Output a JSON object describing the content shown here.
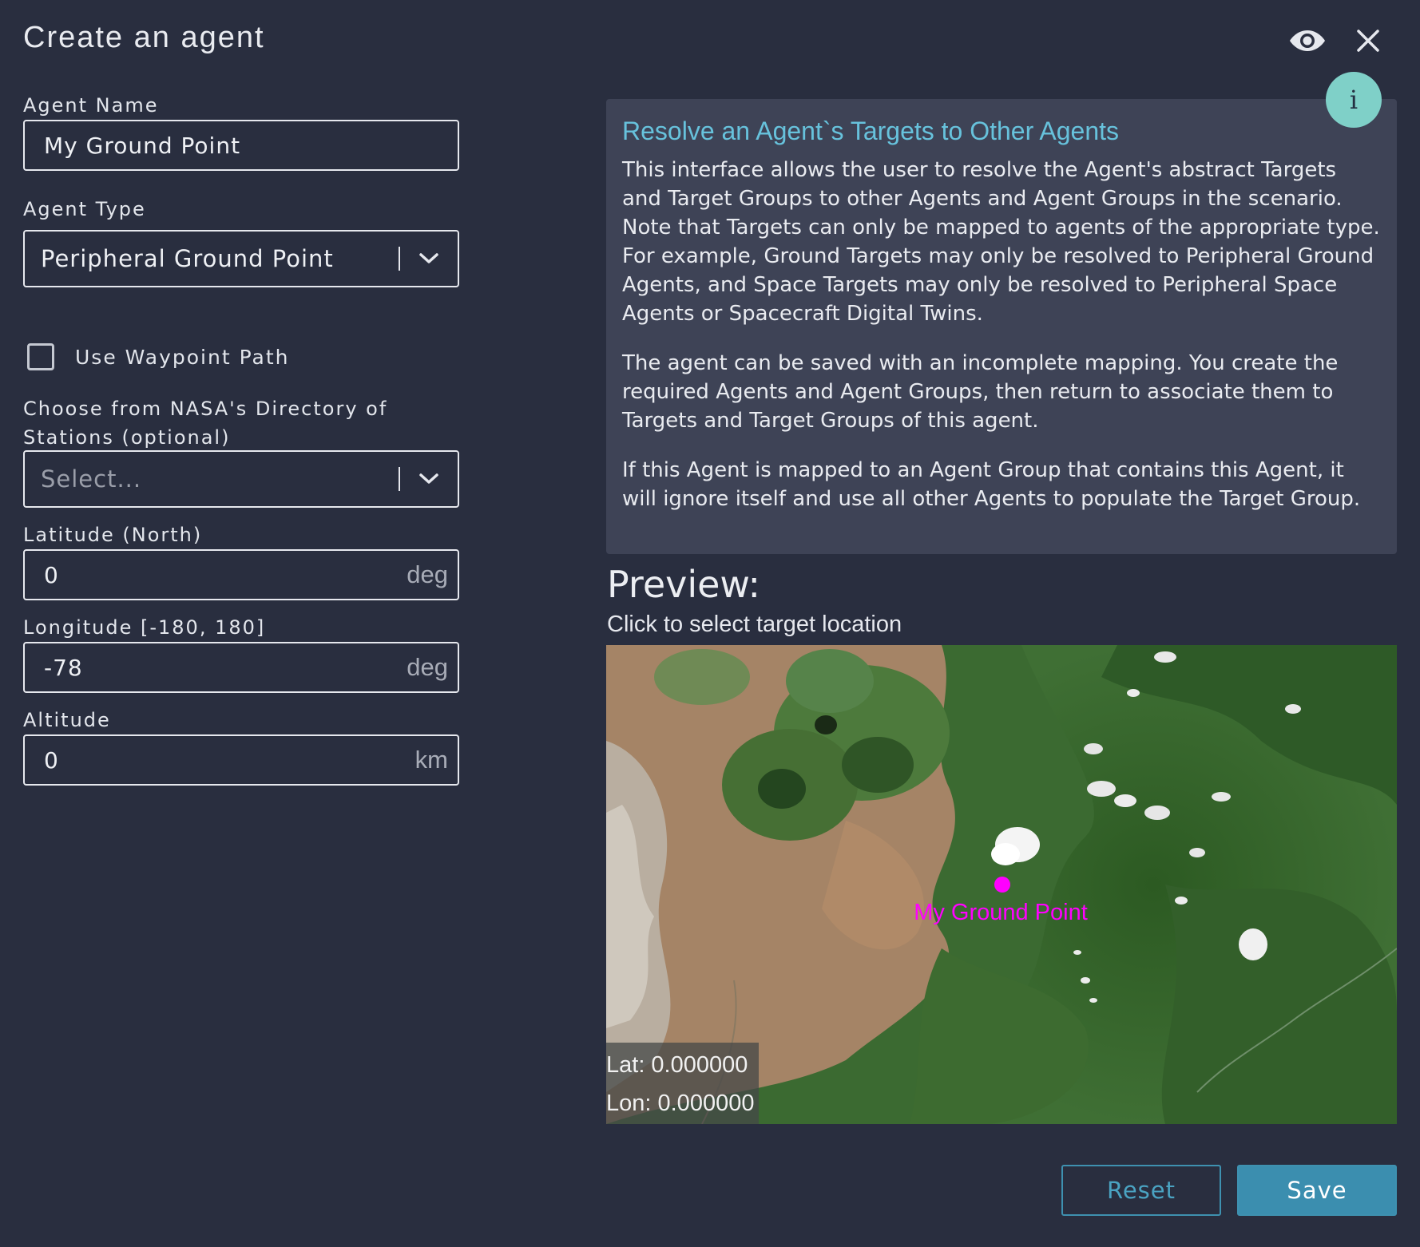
{
  "dialog": {
    "title": "Create an agent"
  },
  "icons": {
    "preview_toggle": "eye-icon",
    "close": "close-icon",
    "info": "info-icon",
    "info_glyph": "i"
  },
  "form": {
    "agent_name": {
      "label": "Agent Name",
      "value": "My Ground Point"
    },
    "agent_type": {
      "label": "Agent Type",
      "value": "Peripheral Ground Point"
    },
    "waypoint": {
      "label": "Use Waypoint Path",
      "checked": false
    },
    "nasa_station": {
      "label": "Choose from NASA's Directory of Stations (optional)",
      "placeholder": "Select..."
    },
    "latitude": {
      "label": "Latitude (North)",
      "value": "0",
      "unit": "deg"
    },
    "longitude": {
      "label": "Longitude [-180, 180]",
      "value": "-78",
      "unit": "deg"
    },
    "altitude": {
      "label": "Altitude",
      "value": "0",
      "unit": "km"
    }
  },
  "info": {
    "title": "Resolve an Agent`s Targets to Other Agents",
    "paragraphs": [
      "This interface allows the user to resolve the Agent's abstract Targets and Target Groups to other Agents and Agent Groups in the scenario. Note that Targets can only be mapped to agents of the appropriate type. For example, Ground Targets may only be resolved to Peripheral Ground Agents, and Space Targets may only be resolved to Peripheral Space Agents or Spacecraft Digital Twins.",
      "The agent can be saved with an incomplete mapping. You create the required Agents and Agent Groups, then return to associate them to Targets and Target Groups of this agent.",
      "If this Agent is mapped to an Agent Group that contains this Agent, it will ignore itself and use all other Agents to populate the Target Group."
    ]
  },
  "preview": {
    "title": "Preview:",
    "subtitle": "Click to select target location",
    "marker_label": "My Ground Point",
    "lat_text": "Lat: 0.000000",
    "lon_text": "Lon: 0.000000"
  },
  "actions": {
    "reset": "Reset",
    "save": "Save"
  },
  "colors": {
    "background": "#292e3f",
    "panel": "#3e4356",
    "accent": "#3b8eaf",
    "info_title": "#67c2dc",
    "marker": "#ff00ff"
  }
}
